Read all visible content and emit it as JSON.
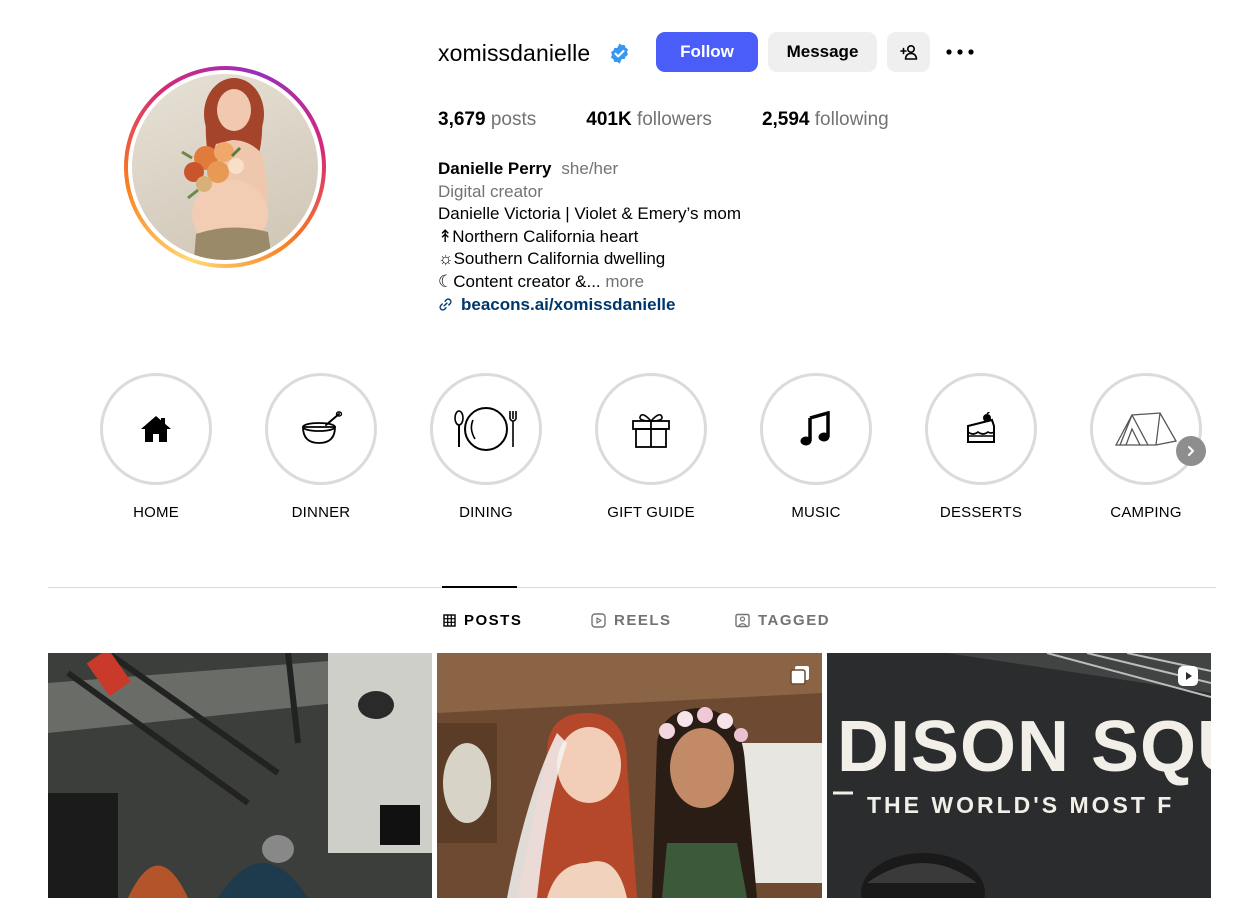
{
  "profile": {
    "username": "xomissdanielle",
    "verified_color": "#3897f0",
    "buttons": {
      "follow": "Follow",
      "message": "Message"
    },
    "stats": [
      {
        "value": "3,679",
        "label": "posts"
      },
      {
        "value": "401K",
        "label": "followers"
      },
      {
        "value": "2,594",
        "label": "following"
      }
    ],
    "bio": {
      "name": "Danielle Perry",
      "pronouns": "she/her",
      "category": "Digital creator",
      "lines": [
        "Danielle Victoria | Violet & Emery’s mom",
        "↟Northern California heart",
        "☼Southern California dwelling"
      ],
      "last_line": "☾Content creator &...",
      "more": "more",
      "link": "beacons.ai/xomissdanielle"
    }
  },
  "highlights": [
    {
      "label": "HOME",
      "icon": "house-icon"
    },
    {
      "label": "DINNER",
      "icon": "bowl-icon"
    },
    {
      "label": "DINING",
      "icon": "plate-icon"
    },
    {
      "label": "GIFT GUIDE",
      "icon": "gift-icon"
    },
    {
      "label": "MUSIC",
      "icon": "music-note-icon"
    },
    {
      "label": "DESSERTS",
      "icon": "cake-icon"
    },
    {
      "label": "CAMPING",
      "icon": "tent-icon"
    }
  ],
  "tabs": [
    {
      "label": "POSTS",
      "icon": "grid-icon",
      "active": true
    },
    {
      "label": "REELS",
      "icon": "reels-icon",
      "active": false
    },
    {
      "label": "TAGGED",
      "icon": "tagged-icon",
      "active": false
    }
  ],
  "posts": [
    {
      "badge": ""
    },
    {
      "badge": "carousel-icon"
    },
    {
      "badge": "reel-icon",
      "sign_text": "DISON SQUA",
      "sign_subtext": "THE WORLD'S MOST F"
    }
  ],
  "colors": {
    "accent": "#4a5df9",
    "link": "#00376b",
    "muted": "#737373"
  }
}
